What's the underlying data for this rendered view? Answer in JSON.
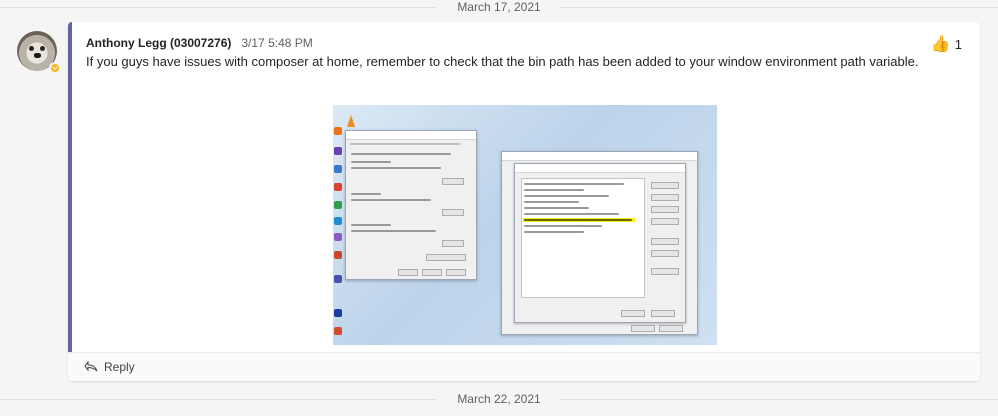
{
  "dates": {
    "top": "March 17, 2021",
    "bottom": "March 22, 2021"
  },
  "message": {
    "author": "Anthony Legg (03007276)",
    "time": "3/17 5:48 PM",
    "text": "If you guys have issues with composer at home, remember to check that the bin path has been added to your window environment path variable.",
    "reaction": {
      "icon": "thumbs-up-icon",
      "count": "1"
    },
    "status_color": "#fcb415",
    "accent_color": "#6264a7"
  },
  "footer": {
    "reply_label": "Reply"
  }
}
